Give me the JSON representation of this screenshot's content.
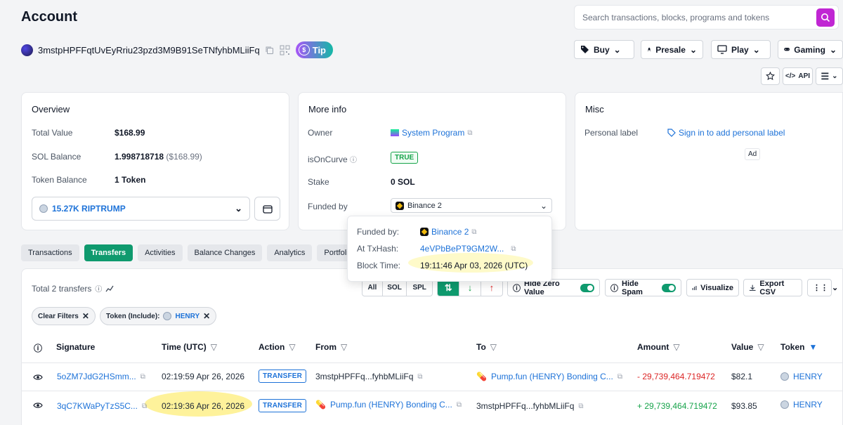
{
  "header": {
    "title": "Account",
    "search_placeholder": "Search transactions, blocks, programs and tokens"
  },
  "account": {
    "address": "3mstpHPFFqtUvEyRriu23pzd3M9B91SeTNfyhbMLiiFq",
    "tip_label": "Tip"
  },
  "top_menu": {
    "buy": "Buy",
    "presale": "Presale",
    "play": "Play",
    "gaming": "Gaming",
    "api": "API"
  },
  "overview": {
    "title": "Overview",
    "total_value_label": "Total Value",
    "total_value": "$168.99",
    "sol_balance_label": "SOL Balance",
    "sol_balance": "1.998718718",
    "sol_balance_usd": "($168.99)",
    "token_balance_label": "Token Balance",
    "token_balance": "1 Token",
    "token_select": "15.27K RIPTRUMP"
  },
  "more_info": {
    "title": "More info",
    "owner_label": "Owner",
    "owner_value": "System Program",
    "curve_label": "isOnCurve",
    "curve_value": "TRUE",
    "stake_label": "Stake",
    "stake_value": "0 SOL",
    "funded_label": "Funded by",
    "funded_value": "Binance 2"
  },
  "misc": {
    "title": "Misc",
    "personal_label": "Personal label",
    "sign_in_link": "Sign in to add personal label",
    "ad": "Ad"
  },
  "popup": {
    "funded_by_label": "Funded by:",
    "funded_by_value": "Binance 2",
    "txhash_label": "At TxHash:",
    "txhash_value": "4eVPbBePT9GM2W...",
    "block_time_label": "Block Time:",
    "block_time_value": "19:11:46 Apr 03, 2026 (UTC)"
  },
  "tabs": [
    "Transactions",
    "Transfers",
    "Activities",
    "Balance Changes",
    "Analytics",
    "Portfolio"
  ],
  "transfers": {
    "total_label": "Total 2 transfers",
    "filter_all": "All",
    "filter_sol": "SOL",
    "filter_spl": "SPL",
    "hide_zero": "Hide Zero Value",
    "hide_spam": "Hide Spam",
    "visualize": "Visualize",
    "export_csv": "Export CSV",
    "clear_filters": "Clear Filters",
    "token_filter_label": "Token (Include):",
    "token_filter_value": "HENRY"
  },
  "table": {
    "headers": {
      "signature": "Signature",
      "time": "Time (UTC)",
      "action": "Action",
      "from": "From",
      "to": "To",
      "amount": "Amount",
      "value": "Value",
      "token": "Token"
    },
    "rows": [
      {
        "signature": "5oZM7JdG2HSmm...",
        "time": "02:19:59 Apr 26, 2026",
        "action": "TRANSFER",
        "from": "3mstpHPFFq...fyhbMLiiFq",
        "to": "Pump.fun (HENRY) Bonding C...",
        "amount": "- 29,739,464.719472",
        "value": "$82.1",
        "token": "HENRY"
      },
      {
        "signature": "3qC7KWaPyTzS5C...",
        "time": "02:19:36 Apr 26, 2026",
        "action": "TRANSFER",
        "from": "Pump.fun (HENRY) Bonding C...",
        "to": "3mstpHPFFq...fyhbMLiiFq",
        "amount": "+ 29,739,464.719472",
        "value": "$93.85",
        "token": "HENRY"
      }
    ]
  },
  "colors": {
    "accent_green": "#0f9a6e",
    "link_blue": "#1d72d8",
    "search_btn": "#c026d3",
    "highlight": "#fef08a"
  }
}
